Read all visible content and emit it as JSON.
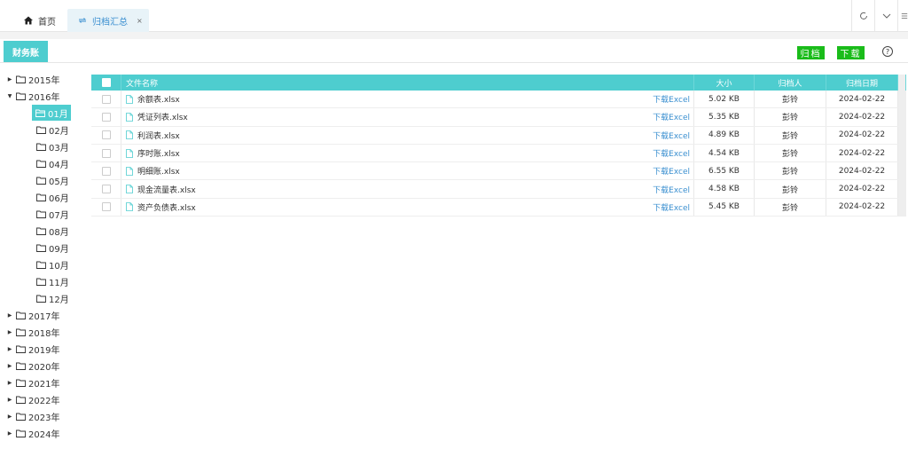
{
  "tabs": {
    "home": "首页",
    "archive": "归档汇总",
    "close": "×"
  },
  "section": {
    "title": "财务账",
    "archive_btn": "归档",
    "download_btn": "下载",
    "help": "?"
  },
  "tree": {
    "years": [
      "2015年",
      "2016年",
      "2017年",
      "2018年",
      "2019年",
      "2020年",
      "2021年",
      "2022年",
      "2023年",
      "2024年"
    ],
    "expanded_year": "2016年",
    "months": [
      "01月",
      "02月",
      "03月",
      "04月",
      "05月",
      "06月",
      "07月",
      "08月",
      "09月",
      "10月",
      "11月",
      "12月"
    ],
    "selected_month": "01月"
  },
  "table": {
    "headers": {
      "name": "文件名称",
      "size": "大小",
      "user": "归档人",
      "date": "归档日期"
    },
    "download_label": "下载Excel",
    "rows": [
      {
        "name": "余额表.xlsx",
        "size": "5.02 KB",
        "user": "彭铃",
        "date": "2024-02-22"
      },
      {
        "name": "凭证列表.xlsx",
        "size": "5.35 KB",
        "user": "彭铃",
        "date": "2024-02-22"
      },
      {
        "name": "利润表.xlsx",
        "size": "4.89 KB",
        "user": "彭铃",
        "date": "2024-02-22"
      },
      {
        "name": "序时账.xlsx",
        "size": "4.54 KB",
        "user": "彭铃",
        "date": "2024-02-22"
      },
      {
        "name": "明细账.xlsx",
        "size": "6.55 KB",
        "user": "彭铃",
        "date": "2024-02-22"
      },
      {
        "name": "现金流量表.xlsx",
        "size": "4.58 KB",
        "user": "彭铃",
        "date": "2024-02-22"
      },
      {
        "name": "资产负债表.xlsx",
        "size": "5.45 KB",
        "user": "彭铃",
        "date": "2024-02-22"
      }
    ]
  },
  "colors": {
    "accent": "#4ecdcf",
    "green": "#1abc1a",
    "link": "#3a8fd0"
  },
  "icons": [
    "home-icon",
    "refresh-icon",
    "reload-icon",
    "chevron-down-icon",
    "settings-icon",
    "folder-icon",
    "folder-open-icon",
    "file-icon",
    "caret-right-icon",
    "caret-down-icon",
    "help-icon"
  ]
}
